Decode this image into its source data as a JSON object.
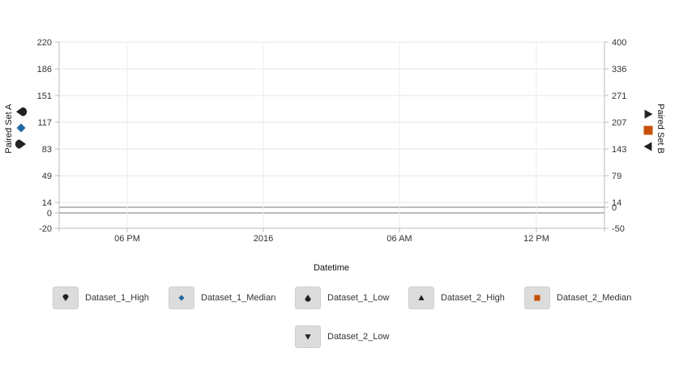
{
  "chart_data": {
    "type": "line",
    "title": "",
    "xlabel": "Datetime",
    "x_ticks": [
      "06 PM",
      "2016",
      "06 AM",
      "12 PM"
    ],
    "y_left": {
      "label": "Paired Set A",
      "ticks": [
        220,
        186,
        151,
        117,
        83,
        49,
        14,
        0,
        -20
      ],
      "range": [
        -20,
        220
      ]
    },
    "y_right": {
      "label": "Paired Set B",
      "ticks": [
        400,
        336,
        271,
        207,
        143,
        79,
        14,
        0,
        -50
      ],
      "range": [
        -50,
        400
      ]
    },
    "grid": true,
    "legend_position": "bottom",
    "series": [
      {
        "name": "Dataset_1_High",
        "axis": "left",
        "marker": "teardrop-down",
        "color": "#222222",
        "values": []
      },
      {
        "name": "Dataset_1_Median",
        "axis": "left",
        "marker": "diamond",
        "color": "#1f6aa5",
        "values": []
      },
      {
        "name": "Dataset_1_Low",
        "axis": "left",
        "marker": "teardrop-up",
        "color": "#222222",
        "values": []
      },
      {
        "name": "Dataset_2_High",
        "axis": "right",
        "marker": "triangle-up",
        "color": "#222222",
        "values": []
      },
      {
        "name": "Dataset_2_Median",
        "axis": "right",
        "marker": "square",
        "color": "#c8500a",
        "values": []
      },
      {
        "name": "Dataset_2_Low",
        "axis": "right",
        "marker": "triangle-down",
        "color": "#222222",
        "values": []
      }
    ]
  }
}
